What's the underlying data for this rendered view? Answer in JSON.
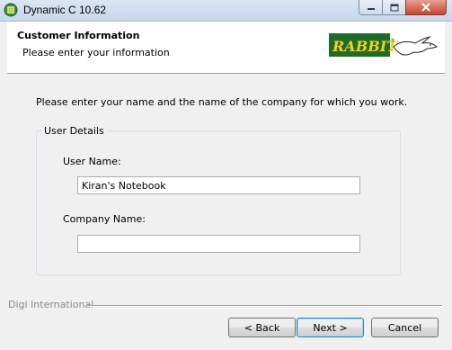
{
  "window": {
    "title": "Dynamic C 10.62"
  },
  "header": {
    "title": "Customer Information",
    "subtitle": "Please enter your information",
    "logo_text": "RABBIT"
  },
  "main": {
    "intro": "Please enter your name and the name of the company for which you work.",
    "group_label": "User Details",
    "user_name_label": "User Name:",
    "user_name_value": "Kiran's Notebook",
    "company_name_label": "Company Name:",
    "company_name_value": ""
  },
  "footer": {
    "brand": "Digi International",
    "back_label": "< Back",
    "next_label": "Next >",
    "cancel_label": "Cancel"
  },
  "colors": {
    "logo_bg": "#1e6b2a",
    "logo_text": "#f2d21b",
    "close_button": "#c4452c"
  },
  "icons": {
    "app": "dynamic-c-app-icon",
    "minimize": "minimize-icon",
    "maximize": "maximize-icon",
    "close": "close-icon"
  }
}
